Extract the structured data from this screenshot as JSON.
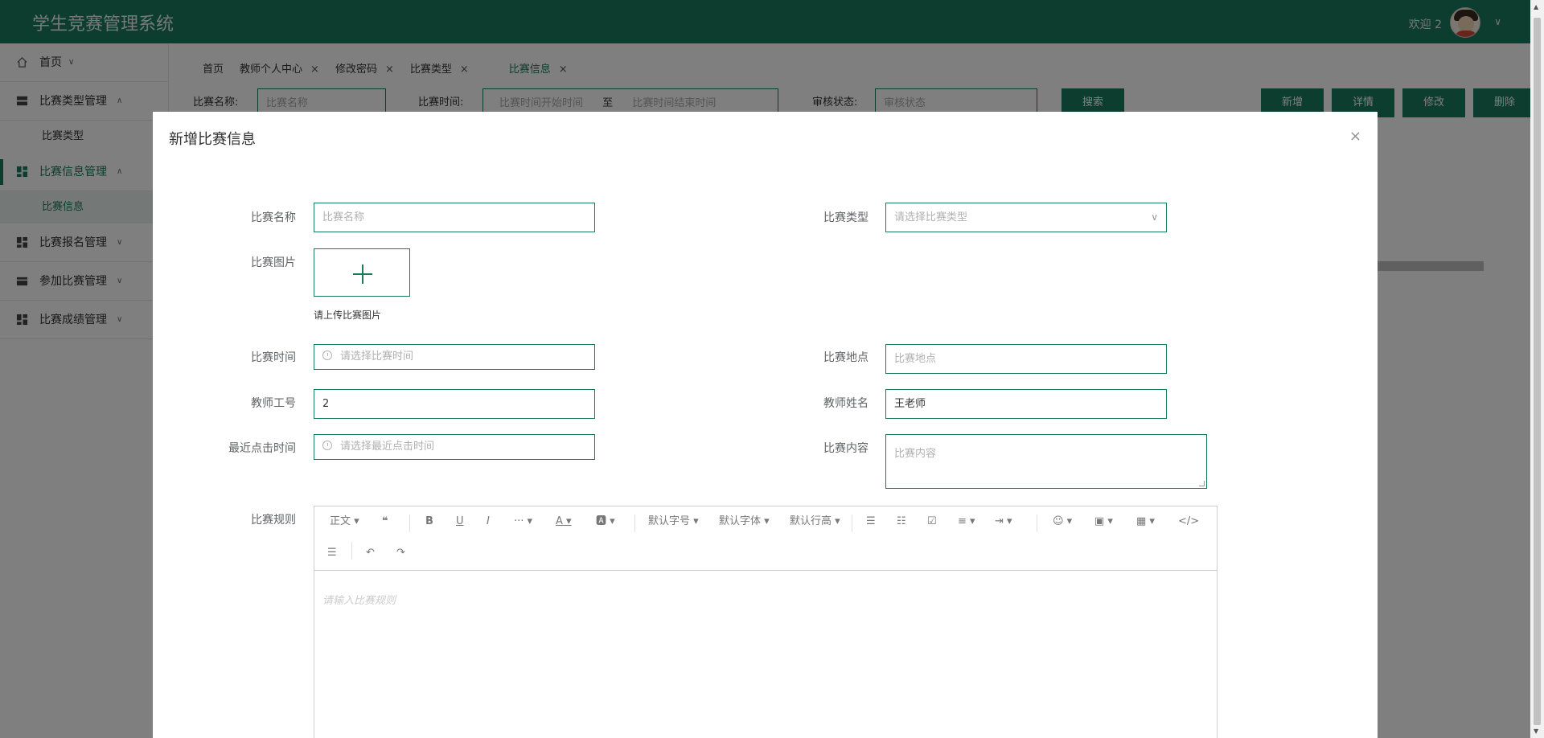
{
  "header": {
    "app_title": "学生竞赛管理系统",
    "welcome": "欢迎 2",
    "user_menu_icon": "chevron-down-icon"
  },
  "sidebar": {
    "items": [
      {
        "label": "首页",
        "icon": "home-icon",
        "chevron": "∨"
      },
      {
        "label": "比赛类型管理",
        "icon": "table-icon",
        "chevron": "∧"
      },
      {
        "label": "比赛类型",
        "sub": true
      },
      {
        "label": "比赛信息管理",
        "icon": "dashboard-icon",
        "chevron": "∧",
        "active": true
      },
      {
        "label": "比赛信息",
        "sub": true,
        "active": true
      },
      {
        "label": "比赛报名管理",
        "icon": "dashboard-icon",
        "chevron": "∨"
      },
      {
        "label": "参加比赛管理",
        "icon": "wallet-icon",
        "chevron": "∨"
      },
      {
        "label": "比赛成绩管理",
        "icon": "dashboard-icon",
        "chevron": "∨"
      }
    ]
  },
  "tabs": [
    {
      "label": "首页",
      "closable": false
    },
    {
      "label": "教师个人中心",
      "closable": true
    },
    {
      "label": "修改密码",
      "closable": true
    },
    {
      "label": "比赛类型",
      "closable": true
    },
    {
      "label": "比赛信息",
      "closable": true,
      "active": true
    }
  ],
  "search": {
    "name_label": "比赛名称:",
    "name_placeholder": "比赛名称",
    "time_label": "比赛时间:",
    "time_start_placeholder": "比赛时间开始时间",
    "time_sep": "至",
    "time_end_placeholder": "比赛时间结束时间",
    "status_label": "审核状态:",
    "status_placeholder": "审核状态",
    "search_button": "搜索",
    "add_button": "新增",
    "detail_button": "详情",
    "edit_button": "修改",
    "delete_button": "删除"
  },
  "dialog": {
    "title": "新增比赛信息",
    "close": "×",
    "fields": {
      "name_label": "比赛名称",
      "name_placeholder": "比赛名称",
      "type_label": "比赛类型",
      "type_placeholder": "请选择比赛类型",
      "image_label": "比赛图片",
      "image_tip": "请上传比赛图片",
      "time_label": "比赛时间",
      "time_placeholder": "请选择比赛时间",
      "place_label": "比赛地点",
      "place_placeholder": "比赛地点",
      "teacher_id_label": "教师工号",
      "teacher_id_value": "2",
      "teacher_name_label": "教师姓名",
      "teacher_name_value": "王老师",
      "last_click_label": "最近点击时间",
      "last_click_placeholder": "请选择最近点击时间",
      "content_label": "比赛内容",
      "content_placeholder": "比赛内容",
      "rules_label": "比赛规则",
      "rules_placeholder": "请输入比赛规则"
    },
    "editor_toolbar": {
      "paragraph": "正文 ▾",
      "quote": "❝",
      "bold": "B",
      "underline": "U",
      "italic": "I",
      "more": "··· ▾",
      "font_color": "A ▾",
      "bg_color": "🅰 ▾",
      "font_size": "默认字号 ▾",
      "font_family": "默认字体 ▾",
      "line_height": "默认行高 ▾",
      "bullet_list": "☰",
      "number_list": "☷",
      "todo": "☑",
      "align": "≡ ▾",
      "indent": "⇥ ▾",
      "emoji": "☺ ▾",
      "image": "▣ ▾",
      "table": "▦ ▾",
      "code": "</>",
      "divider": "☰",
      "undo": "↶",
      "redo": "↷"
    }
  }
}
